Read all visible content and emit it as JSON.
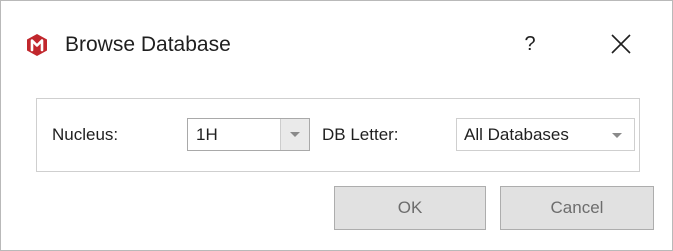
{
  "window": {
    "title": "Browse Database",
    "help_label": "?",
    "accent_color": "#c1272d"
  },
  "icons": {
    "app": "app-logo-icon",
    "close": "close-icon",
    "dropdown": "chevron-down-icon"
  },
  "form": {
    "nucleus_label": "Nucleus:",
    "nucleus_value": "1H",
    "db_letter_label": "DB Letter:",
    "db_letter_value": "All Databases"
  },
  "buttons": {
    "ok_label": "OK",
    "cancel_label": "Cancel"
  }
}
